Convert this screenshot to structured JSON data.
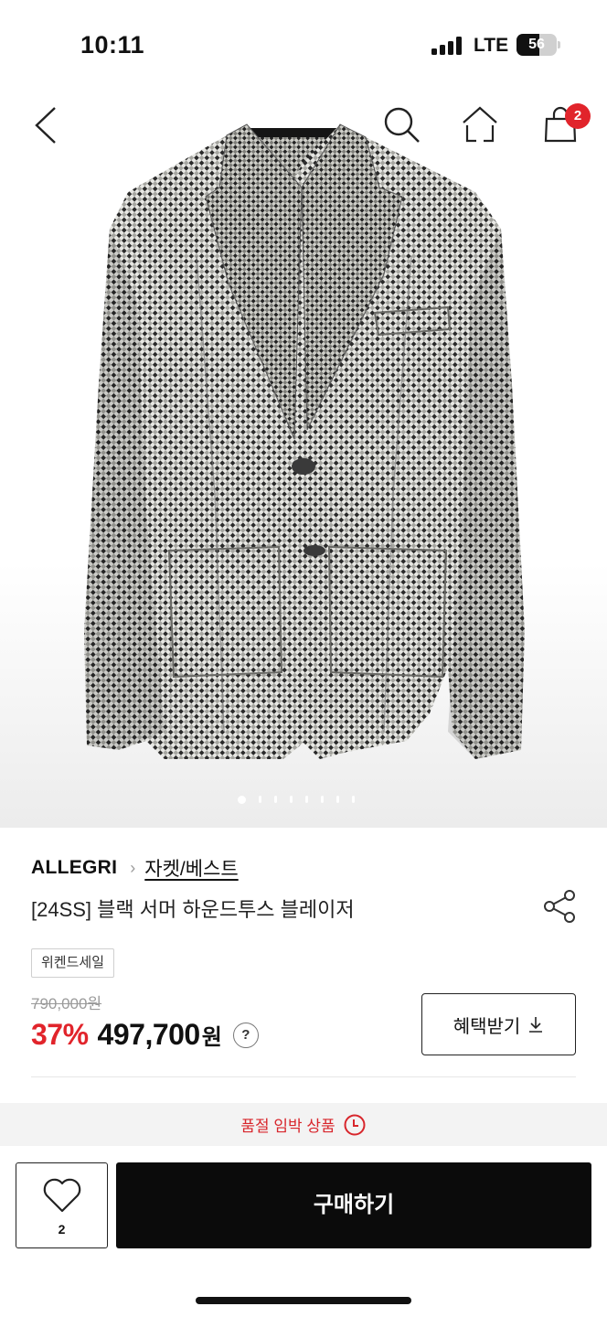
{
  "status_bar": {
    "time": "10:11",
    "network": "LTE",
    "battery": "56",
    "battery_level": 0.56
  },
  "nav": {
    "back_icon": "chevron-left-icon",
    "search_icon": "search-icon",
    "home_icon": "home-icon",
    "cart_icon": "shopping-bag-icon",
    "cart_count": "2"
  },
  "gallery": {
    "image_count": 8,
    "active_index": 0
  },
  "product": {
    "brand": "ALLEGRI",
    "category": "자켓/베스트",
    "title": "[24SS] 블랙 서머 하운드투스 블레이저",
    "tag": "위켄드세일",
    "original_price": "790,000원",
    "discount": "37%",
    "price": "497,700",
    "price_unit": "원",
    "help_label": "?",
    "benefit_button": "혜택받기",
    "share_icon": "share-icon"
  },
  "stock_notice": {
    "text": "품절 임박 상품",
    "icon": "clock-icon",
    "color": "#d8262c"
  },
  "bottom_bar": {
    "wish_icon": "heart-icon",
    "wish_count": "2",
    "buy_label": "구매하기"
  },
  "colors": {
    "accent": "#e1242b",
    "buy_button": "#0b0b0b"
  }
}
